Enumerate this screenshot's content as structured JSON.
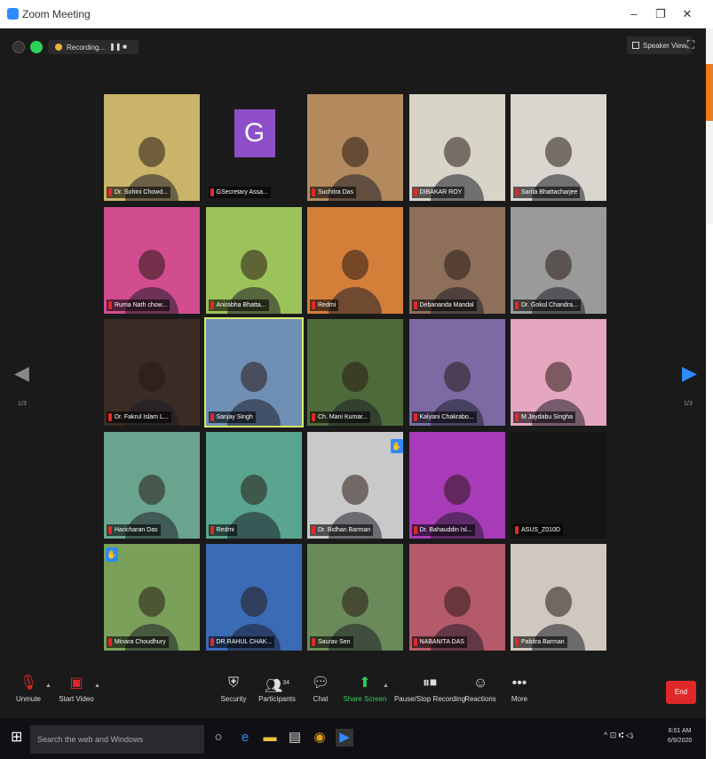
{
  "window": {
    "title": "Zoom Meeting",
    "minimize": "–",
    "restore": "❐",
    "close": "✕"
  },
  "topbar": {
    "recording_label": "Recording...",
    "pause_icon": "pause-icon",
    "stop_icon": "stop-icon",
    "speaker_view_label": "Speaker View"
  },
  "pager": {
    "left_label": "1/3",
    "right_label": "1/3"
  },
  "participants": [
    {
      "name": "Dr. Sohini Chowd...",
      "bg": "#c9b46a"
    },
    {
      "name": "GSecretary Assa...",
      "bg": "#1b1b1b",
      "avatar": "G"
    },
    {
      "name": "Suchitra Das",
      "bg": "#b38a5e"
    },
    {
      "name": "DIBAKAR ROY",
      "bg": "#d8d4c8"
    },
    {
      "name": "Sarita Bhattacharjee",
      "bg": "#d9d6cf"
    },
    {
      "name": "Ruma Nath chow...",
      "bg": "#d14d8f"
    },
    {
      "name": "Anirabha Bhatta...",
      "bg": "#9cc25a"
    },
    {
      "name": "Redmi",
      "bg": "#d37f3a"
    },
    {
      "name": "Debananda Mandal",
      "bg": "#8d6f5a"
    },
    {
      "name": "Dr. Gokul Chandra...",
      "bg": "#9a9a9a"
    },
    {
      "name": "Dr. Fakrul Islam L...",
      "bg": "#3a2c24"
    },
    {
      "name": "Sanjay Singh",
      "bg": "#6f8fb5"
    },
    {
      "name": "Ch. Mani Kumar...",
      "bg": "#4f6a3a"
    },
    {
      "name": "Kalyani Chakrabo...",
      "bg": "#7d6aa5"
    },
    {
      "name": "M Jaydabu Singha",
      "bg": "#e5a6c0"
    },
    {
      "name": "Haricharan Das",
      "bg": "#6aa48f"
    },
    {
      "name": "Redmi",
      "bg": "#5aa58f"
    },
    {
      "name": "Dr. Bidhan Barman",
      "bg": "#c9c9c9"
    },
    {
      "name": "Dr. Bahauddin Isl...",
      "bg": "#a83bb8"
    },
    {
      "name": "ASUS_Z010D",
      "bg": "#151515"
    },
    {
      "name": "Minara Choudhury",
      "bg": "#7aa05a"
    },
    {
      "name": "DR.RAHUL CHAK...",
      "bg": "#3b6bb5"
    },
    {
      "name": "Saurav Sen",
      "bg": "#6a8a5a"
    },
    {
      "name": "NABANITA DAS",
      "bg": "#b55a6a"
    },
    {
      "name": "Pabitra Barman",
      "bg": "#cfc8bf"
    }
  ],
  "toolbar": {
    "unmute": "Unmute",
    "start_video": "Start Video",
    "security": "Security",
    "participants": "Participants",
    "participants_count": "34",
    "chat": "Chat",
    "share_screen": "Share Screen",
    "recording": "Pause/Stop Recording",
    "reactions": "Reactions",
    "more": "More",
    "end": "End"
  },
  "taskbar": {
    "search_placeholder": "Search the web and Windows",
    "time": "6:01 AM",
    "date": "6/9/2020",
    "tray_text": "^ ⊡ ⑆ ◁ᵢ"
  },
  "colors": {
    "meeting_bg": "#1a1a1a",
    "active_speaker": "#d8e86a",
    "end_red": "#e02828",
    "share_green": "#2fd05a",
    "accent_blue": "#2d8cff",
    "avatar_purple": "#8e4fc8"
  }
}
